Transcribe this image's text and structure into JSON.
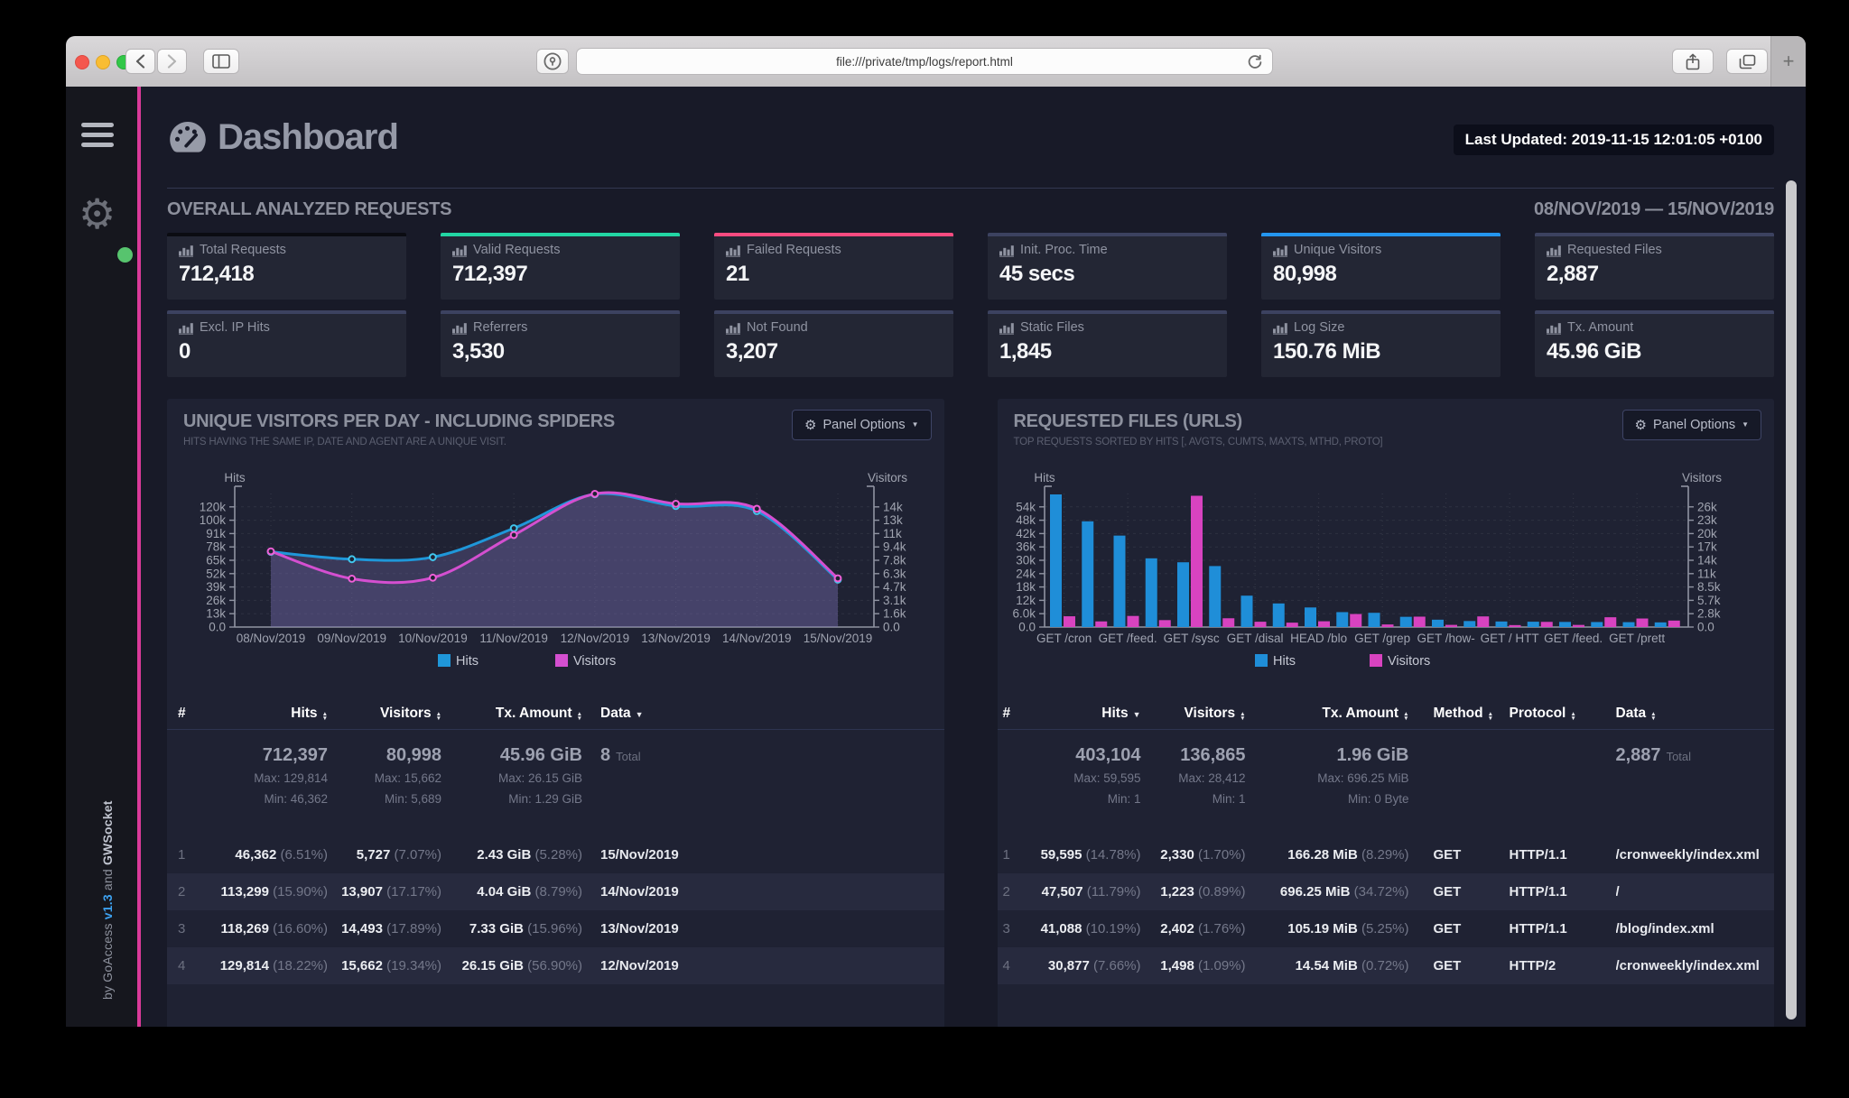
{
  "browser": {
    "url": "file:///private/tmp/logs/report.html",
    "new_tab_label": "+"
  },
  "sidebar": {
    "credit_prefix": "by GoAccess ",
    "credit_version": "v1.3",
    "credit_middle": " and ",
    "credit_socket": "GWSocket"
  },
  "header": {
    "title": "Dashboard",
    "last_updated": "Last Updated: 2019-11-15 12:01:05 +0100"
  },
  "overview": {
    "title": "OVERALL ANALYZED REQUESTS",
    "date_range": "08/NOV/2019 — 15/NOV/2019",
    "cards": [
      {
        "label": "Total Requests",
        "value": "712,418",
        "accent": "#0b0c12"
      },
      {
        "label": "Valid Requests",
        "value": "712,397",
        "accent": "#22d6a4"
      },
      {
        "label": "Failed Requests",
        "value": "21",
        "accent": "#fa4b80"
      },
      {
        "label": "Init. Proc. Time",
        "value": "45 secs",
        "accent": "#3c4260"
      },
      {
        "label": "Unique Visitors",
        "value": "80,998",
        "accent": "#2496ef"
      },
      {
        "label": "Requested Files",
        "value": "2,887",
        "accent": "#3c4260"
      },
      {
        "label": "Excl. IP Hits",
        "value": "0",
        "accent": "#3c4260"
      },
      {
        "label": "Referrers",
        "value": "3,530",
        "accent": "#3c4260"
      },
      {
        "label": "Not Found",
        "value": "3,207",
        "accent": "#3c4260"
      },
      {
        "label": "Static Files",
        "value": "1,845",
        "accent": "#3c4260"
      },
      {
        "label": "Log Size",
        "value": "150.76 MiB",
        "accent": "#3c4260"
      },
      {
        "label": "Tx. Amount",
        "value": "45.96 GiB",
        "accent": "#3c4260"
      }
    ]
  },
  "panels": {
    "visitors": {
      "title": "UNIQUE VISITORS PER DAY - INCLUDING SPIDERS",
      "subtitle": "HITS HAVING THE SAME IP, DATE AND AGENT ARE A UNIQUE VISIT.",
      "options_label": "Panel Options",
      "table": {
        "columns": [
          "#",
          "Hits",
          "Visitors",
          "Tx. Amount",
          "Data"
        ],
        "sorts": [
          "none",
          "both",
          "both",
          "both",
          "desc"
        ],
        "summary": {
          "big": [
            "712,397",
            "80,998",
            "45.96 GiB",
            "8"
          ],
          "big_suffix": "Total",
          "max": [
            "Max: 129,814",
            "Max: 15,662",
            "Max: 26.15 GiB"
          ],
          "min": [
            "Min: 46,362",
            "Min: 5,689",
            "Min: 1.29 GiB"
          ]
        },
        "rows": [
          {
            "idx": "1",
            "hits": "46,362",
            "hits_pct": "(6.51%)",
            "visitors": "5,727",
            "visitors_pct": "(7.07%)",
            "tx": "2.43 GiB",
            "tx_pct": "(5.28%)",
            "data": "15/Nov/2019"
          },
          {
            "idx": "2",
            "hits": "113,299",
            "hits_pct": "(15.90%)",
            "visitors": "13,907",
            "visitors_pct": "(17.17%)",
            "tx": "4.04 GiB",
            "tx_pct": "(8.79%)",
            "data": "14/Nov/2019"
          },
          {
            "idx": "3",
            "hits": "118,269",
            "hits_pct": "(16.60%)",
            "visitors": "14,493",
            "visitors_pct": "(17.89%)",
            "tx": "7.33 GiB",
            "tx_pct": "(15.96%)",
            "data": "13/Nov/2019"
          },
          {
            "idx": "4",
            "hits": "129,814",
            "hits_pct": "(18.22%)",
            "visitors": "15,662",
            "visitors_pct": "(19.34%)",
            "tx": "26.15 GiB",
            "tx_pct": "(56.90%)",
            "data": "12/Nov/2019"
          }
        ]
      }
    },
    "requests": {
      "title": "REQUESTED FILES (URLS)",
      "subtitle": "TOP REQUESTS SORTED BY HITS [, AVGTS, CUMTS, MAXTS, MTHD, PROTO]",
      "options_label": "Panel Options",
      "table": {
        "columns": [
          "#",
          "Hits",
          "Visitors",
          "Tx. Amount",
          "Method",
          "Protocol",
          "Data"
        ],
        "sorts": [
          "none",
          "desc",
          "both",
          "both",
          "both",
          "both",
          "both"
        ],
        "summary": {
          "big": [
            "403,104",
            "136,865",
            "1.96 GiB",
            "2,887"
          ],
          "big_suffix": "Total",
          "max": [
            "Max: 59,595",
            "Max: 28,412",
            "Max: 696.25 MiB"
          ],
          "min": [
            "Min: 1",
            "Min: 1",
            "Min: 0 Byte"
          ]
        },
        "rows": [
          {
            "idx": "1",
            "hits": "59,595",
            "hits_pct": "(14.78%)",
            "visitors": "2,330",
            "visitors_pct": "(1.70%)",
            "tx": "166.28 MiB",
            "tx_pct": "(8.29%)",
            "method": "GET",
            "protocol": "HTTP/1.1",
            "data": "/cronweekly/index.xml"
          },
          {
            "idx": "2",
            "hits": "47,507",
            "hits_pct": "(11.79%)",
            "visitors": "1,223",
            "visitors_pct": "(0.89%)",
            "tx": "696.25 MiB",
            "tx_pct": "(34.72%)",
            "method": "GET",
            "protocol": "HTTP/1.1",
            "data": "/"
          },
          {
            "idx": "3",
            "hits": "41,088",
            "hits_pct": "(10.19%)",
            "visitors": "2,402",
            "visitors_pct": "(1.76%)",
            "tx": "105.19 MiB",
            "tx_pct": "(5.25%)",
            "method": "GET",
            "protocol": "HTTP/1.1",
            "data": "/blog/index.xml"
          },
          {
            "idx": "4",
            "hits": "30,877",
            "hits_pct": "(7.66%)",
            "visitors": "1,498",
            "visitors_pct": "(1.09%)",
            "tx": "14.54 MiB",
            "tx_pct": "(0.72%)",
            "method": "GET",
            "protocol": "HTTP/2",
            "data": "/cronweekly/index.xml"
          }
        ]
      }
    }
  },
  "chart_data": [
    {
      "type": "area",
      "title": "UNIQUE VISITORS PER DAY - INCLUDING SPIDERS",
      "x": [
        "08/Nov/2019",
        "09/Nov/2019",
        "10/Nov/2019",
        "11/Nov/2019",
        "12/Nov/2019",
        "13/Nov/2019",
        "14/Nov/2019",
        "15/Nov/2019"
      ],
      "series": [
        {
          "name": "Hits",
          "axis": "left",
          "color": "#1f97d9",
          "dot": "#41c6ec",
          "values": [
            73500,
            66300,
            68300,
            96550,
            129814,
            118269,
            113299,
            46362
          ]
        },
        {
          "name": "Visitors",
          "axis": "right",
          "color": "#d44fd0",
          "dot": "#ef5fd8",
          "values": [
            8900,
            5689,
            5800,
            10820,
            15662,
            14493,
            13907,
            5727
          ]
        }
      ],
      "left_axis": {
        "label": "Hits",
        "ticks": [
          "120k",
          "100k",
          "91k",
          "78k",
          "65k",
          "52k",
          "39k",
          "26k",
          "13k",
          "0.0"
        ],
        "max": 130500
      },
      "right_axis": {
        "label": "Visitors",
        "ticks": [
          "14k",
          "13k",
          "11k",
          "9.4k",
          "7.8k",
          "6.3k",
          "4.7k",
          "3.1k",
          "1.6k",
          "0.0"
        ],
        "max": 15700
      },
      "legend": [
        "Hits",
        "Visitors"
      ],
      "grid": true,
      "legend_position": "bottom"
    },
    {
      "type": "bar",
      "title": "REQUESTED FILES (URLS)",
      "x_labels": [
        "GET /cron",
        "GET /feed.",
        "GET /sysc",
        "GET /disal",
        "HEAD /blo",
        "GET /grep",
        "GET /how-",
        "GET / HTT",
        "GET /feed.",
        "GET /prett"
      ],
      "series": [
        {
          "name": "Hits",
          "axis": "left",
          "color": "#1f8ed8",
          "values": [
            59595,
            47507,
            41088,
            30877,
            29100,
            27400,
            14100,
            10600,
            8800,
            6700,
            6400,
            4600,
            3300,
            2700,
            2500,
            2400,
            2300,
            2250,
            2200,
            2100
          ]
        },
        {
          "name": "Visitors",
          "axis": "right",
          "color": "#d843c0",
          "values": [
            2330,
            1223,
            2402,
            1498,
            28412,
            1900,
            1150,
            950,
            1250,
            2820,
            560,
            2250,
            470,
            2300,
            420,
            1120,
            460,
            2120,
            1850,
            1400
          ]
        }
      ],
      "left_axis": {
        "label": "Hits",
        "ticks": [
          "54k",
          "48k",
          "42k",
          "36k",
          "30k",
          "24k",
          "18k",
          "12k",
          "6.0k",
          "0.0"
        ],
        "max": 60000
      },
      "right_axis": {
        "label": "Visitors",
        "ticks": [
          "26k",
          "23k",
          "20k",
          "17k",
          "14k",
          "11k",
          "8.5k",
          "5.7k",
          "2.8k",
          "0.0"
        ],
        "max": 28900
      },
      "legend": [
        "Hits",
        "Visitors"
      ],
      "grid": true,
      "legend_position": "bottom"
    }
  ]
}
